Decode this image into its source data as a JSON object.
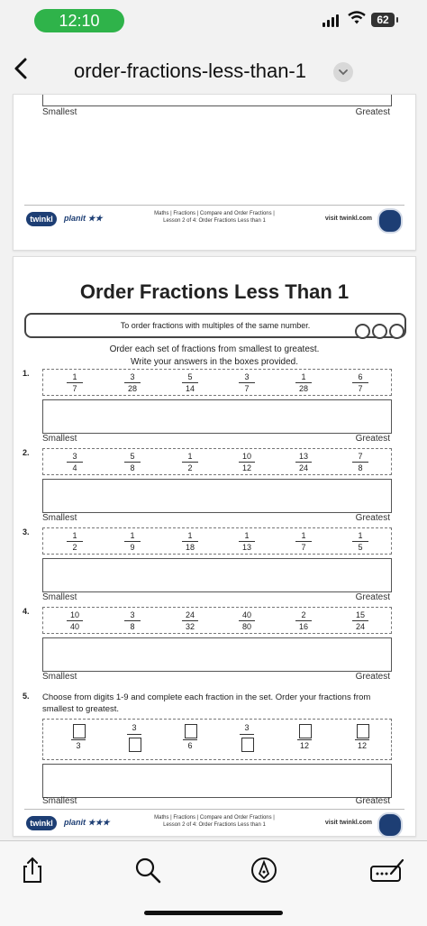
{
  "status_bar": {
    "time": "12:10",
    "battery": "62"
  },
  "nav": {
    "title": "order-fractions-less-than-1"
  },
  "page1": {
    "smallest": "Smallest",
    "greatest": "Greatest",
    "footer": {
      "logo": "twinkl",
      "planit": "planit",
      "stars": "★★",
      "line1": "Maths | Fractions | Compare and Order Fractions |",
      "line2": "Lesson 2 of 4: Order Fractions Less than 1",
      "visit": "visit twinkl.com"
    }
  },
  "page2": {
    "title": "Order Fractions Less Than 1",
    "objective": "To order fractions with multiples of the same number.",
    "instructions_line1": "Order each set of fractions from smallest to greatest.",
    "instructions_line2": "Write your answers in the boxes provided.",
    "smallest": "Smallest",
    "greatest": "Greatest",
    "questions": [
      {
        "num": "1.",
        "fractions": [
          [
            "1",
            "7"
          ],
          [
            "3",
            "28"
          ],
          [
            "5",
            "14"
          ],
          [
            "3",
            "7"
          ],
          [
            "1",
            "28"
          ],
          [
            "6",
            "7"
          ]
        ]
      },
      {
        "num": "2.",
        "fractions": [
          [
            "3",
            "4"
          ],
          [
            "5",
            "8"
          ],
          [
            "1",
            "2"
          ],
          [
            "10",
            "12"
          ],
          [
            "13",
            "24"
          ],
          [
            "7",
            "8"
          ]
        ]
      },
      {
        "num": "3.",
        "fractions": [
          [
            "1",
            "2"
          ],
          [
            "1",
            "9"
          ],
          [
            "1",
            "18"
          ],
          [
            "1",
            "13"
          ],
          [
            "1",
            "7"
          ],
          [
            "1",
            "5"
          ]
        ]
      },
      {
        "num": "4.",
        "fractions": [
          [
            "10",
            "40"
          ],
          [
            "3",
            "8"
          ],
          [
            "24",
            "32"
          ],
          [
            "40",
            "80"
          ],
          [
            "2",
            "16"
          ],
          [
            "15",
            "24"
          ]
        ]
      }
    ],
    "q5": {
      "num": "5.",
      "text": "Choose from digits 1-9 and complete each fraction in the set. Order your fractions from smallest to greatest.",
      "values": [
        "3",
        "3",
        "6",
        "3",
        "12",
        "12"
      ]
    },
    "footer": {
      "logo": "twinkl",
      "planit": "planit",
      "stars": "★★★",
      "line1": "Maths | Fractions | Compare and Order Fractions |",
      "line2": "Lesson 2 of 4: Order Fractions Less than 1",
      "visit": "visit twinkl.com"
    }
  },
  "toolbar": {
    "share": "share-icon",
    "search": "search-icon",
    "markup": "markup-icon",
    "signature": "signature-icon"
  }
}
